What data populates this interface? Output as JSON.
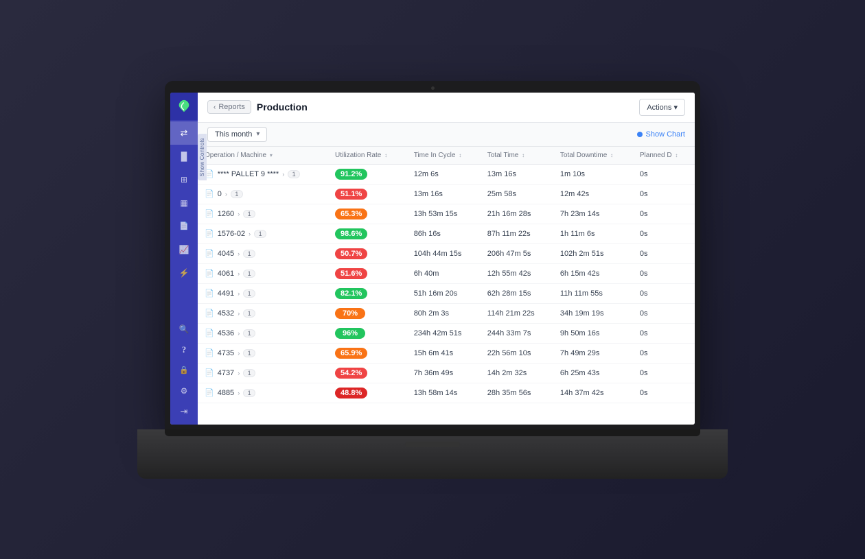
{
  "app": {
    "title": "Production",
    "breadcrumb_back": "Reports"
  },
  "toolbar": {
    "actions_label": "Actions ▾",
    "month_filter": "This month",
    "show_chart": "Show Chart"
  },
  "table": {
    "columns": [
      {
        "key": "name",
        "label": "Operation / Machine",
        "sortable": true
      },
      {
        "key": "utilization",
        "label": "Utilization Rate",
        "sortable": true
      },
      {
        "key": "time_in_cycle",
        "label": "Time In Cycle",
        "sortable": true
      },
      {
        "key": "total_time",
        "label": "Total Time",
        "sortable": true
      },
      {
        "key": "total_downtime",
        "label": "Total Downtime",
        "sortable": true
      },
      {
        "key": "planned",
        "label": "Planned D",
        "sortable": true
      }
    ],
    "rows": [
      {
        "name": "**** PALLET 9 ****",
        "count": 1,
        "utilization": "91.2%",
        "util_class": "util-green",
        "time_in_cycle": "12m 6s",
        "total_time": "13m 16s",
        "total_downtime": "1m 10s",
        "planned": "0s"
      },
      {
        "name": "0",
        "count": 1,
        "utilization": "51.1%",
        "util_class": "util-red",
        "time_in_cycle": "13m 16s",
        "total_time": "25m 58s",
        "total_downtime": "12m 42s",
        "planned": "0s"
      },
      {
        "name": "1260",
        "count": 1,
        "utilization": "65.3%",
        "util_class": "util-orange",
        "time_in_cycle": "13h 53m 15s",
        "total_time": "21h 16m 28s",
        "total_downtime": "7h 23m 14s",
        "planned": "0s"
      },
      {
        "name": "1576-02",
        "count": 1,
        "utilization": "98.6%",
        "util_class": "util-green",
        "time_in_cycle": "86h 16s",
        "total_time": "87h 11m 22s",
        "total_downtime": "1h 11m 6s",
        "planned": "0s"
      },
      {
        "name": "4045",
        "count": 1,
        "utilization": "50.7%",
        "util_class": "util-red",
        "time_in_cycle": "104h 44m 15s",
        "total_time": "206h 47m 5s",
        "total_downtime": "102h 2m 51s",
        "planned": "0s"
      },
      {
        "name": "4061",
        "count": 1,
        "utilization": "51.6%",
        "util_class": "util-red",
        "time_in_cycle": "6h 40m",
        "total_time": "12h 55m 42s",
        "total_downtime": "6h 15m 42s",
        "planned": "0s"
      },
      {
        "name": "4491",
        "count": 1,
        "utilization": "82.1%",
        "util_class": "util-green",
        "time_in_cycle": "51h 16m 20s",
        "total_time": "62h 28m 15s",
        "total_downtime": "11h 11m 55s",
        "planned": "0s"
      },
      {
        "name": "4532",
        "count": 1,
        "utilization": "70%",
        "util_class": "util-orange",
        "time_in_cycle": "80h 2m 3s",
        "total_time": "114h 21m 22s",
        "total_downtime": "34h 19m 19s",
        "planned": "0s"
      },
      {
        "name": "4536",
        "count": 1,
        "utilization": "96%",
        "util_class": "util-green",
        "time_in_cycle": "234h 42m 51s",
        "total_time": "244h 33m 7s",
        "total_downtime": "9h 50m 16s",
        "planned": "0s"
      },
      {
        "name": "4735",
        "count": 1,
        "utilization": "65.9%",
        "util_class": "util-orange",
        "time_in_cycle": "15h 6m 41s",
        "total_time": "22h 56m 10s",
        "total_downtime": "7h 49m 29s",
        "planned": "0s"
      },
      {
        "name": "4737",
        "count": 1,
        "utilization": "54.2%",
        "util_class": "util-red",
        "time_in_cycle": "7h 36m 49s",
        "total_time": "14h 2m 32s",
        "total_downtime": "6h 25m 43s",
        "planned": "0s"
      },
      {
        "name": "4885",
        "count": 1,
        "utilization": "48.8%",
        "util_class": "util-dark-red",
        "time_in_cycle": "13h 58m 14s",
        "total_time": "28h 35m 56s",
        "total_downtime": "14h 37m 42s",
        "planned": "0s"
      }
    ]
  },
  "sidebar": {
    "logo_icon": "🌿",
    "items": [
      {
        "name": "filter-icon",
        "icon": "⇄",
        "active": true
      },
      {
        "name": "chart-icon",
        "icon": "📊"
      },
      {
        "name": "grid-icon",
        "icon": "⊞"
      },
      {
        "name": "layers-icon",
        "icon": "▦"
      },
      {
        "name": "file-icon",
        "icon": "📄"
      },
      {
        "name": "bar-chart-icon",
        "icon": "▐"
      },
      {
        "name": "lightning-icon",
        "icon": "⚡"
      }
    ],
    "bottom_items": [
      {
        "name": "search-icon",
        "icon": "🔍"
      },
      {
        "name": "help-icon",
        "icon": "?"
      },
      {
        "name": "lock-icon",
        "icon": "🔒"
      },
      {
        "name": "gear-icon",
        "icon": "⚙"
      },
      {
        "name": "logout-icon",
        "icon": "→"
      }
    ]
  }
}
